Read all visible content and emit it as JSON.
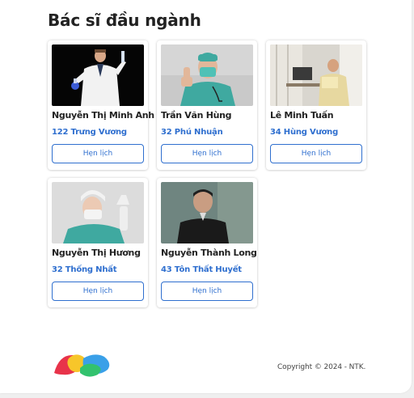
{
  "section": {
    "title": "Bác sĩ đầu ngành"
  },
  "doctors": [
    {
      "name": "Nguyễn Thị Minh Anh",
      "address": "122 Trưng Vương",
      "button_label": "Hẹn lịch"
    },
    {
      "name": "Trần Văn Hùng",
      "address": "32 Phú Nhuận",
      "button_label": "Hẹn lịch"
    },
    {
      "name": "Lê Minh Tuấn",
      "address": "34 Hùng Vương",
      "button_label": "Hẹn lịch"
    },
    {
      "name": "Nguyễn Thị Hương",
      "address": "32 Thống Nhất",
      "button_label": "Hẹn lịch"
    },
    {
      "name": "Nguyễn Thành Long",
      "address": "43 Tôn Thất Huyết",
      "button_label": "Hẹn lịch"
    }
  ],
  "footer": {
    "copyright": "Copyright © 2024 - NTK."
  },
  "colors": {
    "accent": "#2f6fcf",
    "logo_red": "#e8334a",
    "logo_yellow": "#f7c62a",
    "logo_blue": "#3aa0e8",
    "logo_green": "#33c26e"
  }
}
